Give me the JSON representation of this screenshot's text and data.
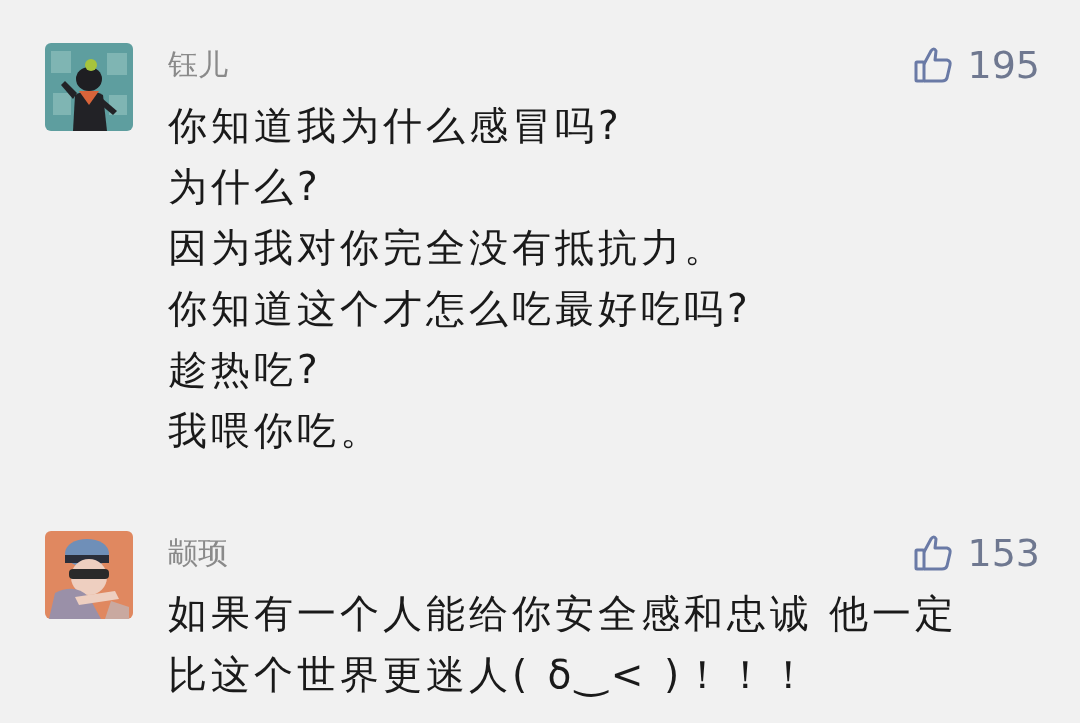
{
  "comments": [
    {
      "author": "钰儿",
      "likes": "195",
      "lines": [
        "你知道我为什么感冒吗?",
        "为什么?",
        "因为我对你完全没有抵抗力。",
        "你知道这个才怎么吃最好吃吗?",
        "趁热吃?",
        "我喂你吃。"
      ]
    },
    {
      "author": "颛顼",
      "likes": "153",
      "lines": [
        "如果有一个人能给你安全感和忠诚 他一定",
        "比这个世界更迷人( δ‿< )！！！"
      ]
    }
  ]
}
